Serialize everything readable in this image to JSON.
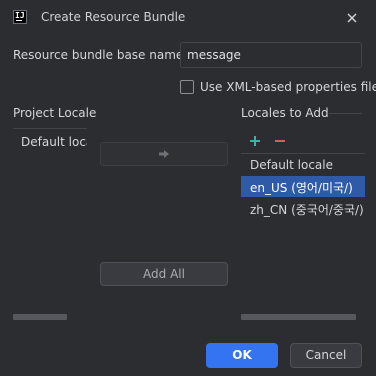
{
  "window": {
    "title": "Create Resource Bundle",
    "app_icon_text": "IJ"
  },
  "form": {
    "base_name_label": "Resource bundle base name:",
    "base_name_value": "message",
    "xml_checkbox_label": "Use XML-based properties files",
    "xml_checked": false
  },
  "project_locales": {
    "header": "Project Locale",
    "items": [
      "Default loca"
    ]
  },
  "locales_to_add": {
    "header": "Locales to Add",
    "items": [
      "Default locale",
      "en_US (영어/미국/)",
      "zh_CN (중국어/중국/)"
    ],
    "selected_index": 1
  },
  "buttons": {
    "add_all": "Add All",
    "ok": "OK",
    "cancel": "Cancel"
  },
  "colors": {
    "accent": "#3574f0",
    "selection": "#2e5aa8",
    "add_icon": "#3fb2a5",
    "remove_icon": "#db5c5c",
    "background": "#2b2d30"
  }
}
